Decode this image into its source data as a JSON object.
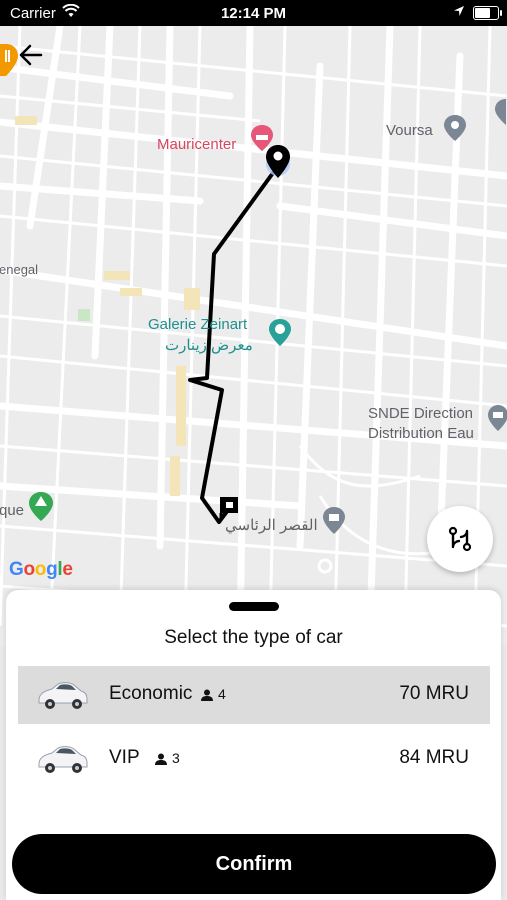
{
  "status_bar": {
    "carrier": "Carrier",
    "time": "12:14 PM"
  },
  "map": {
    "labels": {
      "mauricenter": "Mauricenter",
      "voursa": "Voursa",
      "senegal": "enegal",
      "galerie_latin": "Galerie Zeinart",
      "galerie_arabic": "معرض زينارت",
      "snde_line1": "SNDE Direction",
      "snde_line2": "Distribution Eau",
      "palace_arabic": "القصر الرئاسي",
      "que": "que"
    },
    "provider": "Google"
  },
  "sheet": {
    "title": "Select the type of car",
    "cars": [
      {
        "name": "Economic",
        "passengers": "4",
        "price": "70 MRU",
        "selected": true
      },
      {
        "name": "VIP",
        "passengers": "3",
        "price": "84 MRU",
        "selected": false
      }
    ]
  },
  "confirm_label": "Confirm"
}
